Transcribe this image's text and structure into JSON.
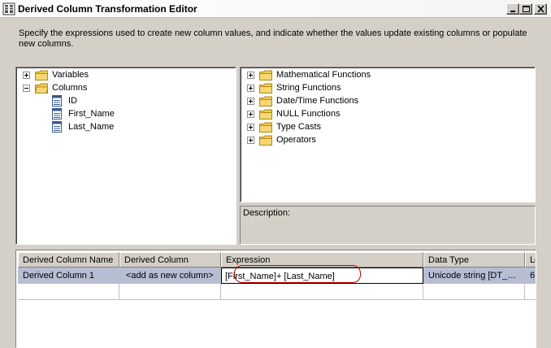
{
  "window": {
    "title": "Derived Column Transformation Editor"
  },
  "instructions": "Specify the expressions used to create new column values, and indicate whether the values update existing columns or populate new columns.",
  "left_tree": {
    "variables": "Variables",
    "columns": "Columns",
    "column_items": [
      "ID",
      "First_Name",
      "Last_Name"
    ]
  },
  "right_tree": {
    "items": [
      "Mathematical Functions",
      "String Functions",
      "Date/Time Functions",
      "NULL Functions",
      "Type Casts",
      "Operators"
    ]
  },
  "description": {
    "label": "Description:"
  },
  "grid": {
    "headers": [
      "Derived Column Name",
      "Derived Column",
      "Expression",
      "Data Type",
      "Le"
    ],
    "rows": [
      {
        "name": "Derived Column 1",
        "derived_column": "<add as new column>",
        "expression": "[First_Name]+ [Last_Name]",
        "data_type": "Unicode string [DT_…",
        "length": "6"
      }
    ]
  },
  "colors": {
    "highlight": "#c00000",
    "selected_row": "#b7bdd2",
    "folder": "#f2c94c"
  }
}
